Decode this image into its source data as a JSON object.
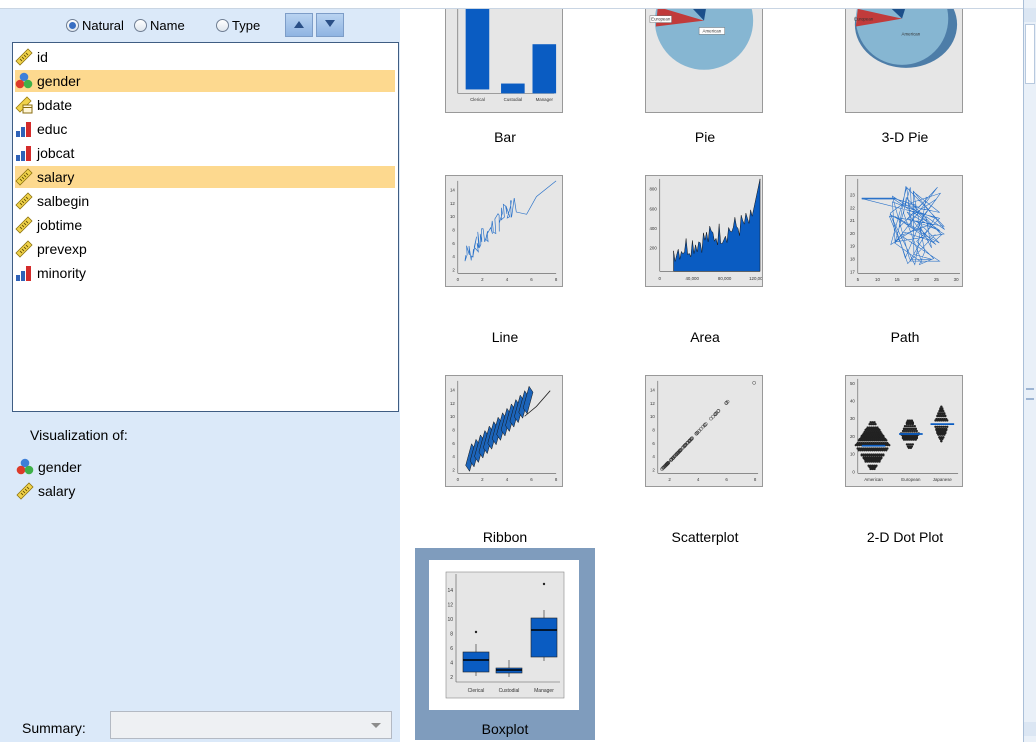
{
  "sort_options": [
    {
      "label": "Natural",
      "selected": true
    },
    {
      "label": "Name",
      "selected": false
    },
    {
      "label": "Type",
      "selected": false
    }
  ],
  "variables": [
    {
      "name": "id",
      "measure": "scale",
      "selected": false
    },
    {
      "name": "gender",
      "measure": "nominal",
      "selected": true
    },
    {
      "name": "bdate",
      "measure": "date",
      "selected": false
    },
    {
      "name": "educ",
      "measure": "ordinal",
      "selected": false
    },
    {
      "name": "jobcat",
      "measure": "ordinal",
      "selected": false
    },
    {
      "name": "salary",
      "measure": "scale",
      "selected": true
    },
    {
      "name": "salbegin",
      "measure": "scale",
      "selected": false
    },
    {
      "name": "jobtime",
      "measure": "scale",
      "selected": false
    },
    {
      "name": "prevexp",
      "measure": "scale",
      "selected": false
    },
    {
      "name": "minority",
      "measure": "ordinal",
      "selected": false
    }
  ],
  "visualization": {
    "label": "Visualization of:",
    "items": [
      {
        "name": "gender",
        "measure": "nominal"
      },
      {
        "name": "salary",
        "measure": "scale"
      }
    ]
  },
  "summary": {
    "label": "Summary:",
    "value": ""
  },
  "charts": [
    {
      "label": "Bar",
      "selected": false
    },
    {
      "label": "Pie",
      "selected": false
    },
    {
      "label": "3-D Pie",
      "selected": false
    },
    {
      "label": "Line",
      "selected": false
    },
    {
      "label": "Area",
      "selected": false
    },
    {
      "label": "Path",
      "selected": false
    },
    {
      "label": "Ribbon",
      "selected": false
    },
    {
      "label": "Scatterplot",
      "selected": false
    },
    {
      "label": "2-D Dot Plot",
      "selected": false
    },
    {
      "label": "Boxplot",
      "selected": true
    }
  ],
  "thumb_text": {
    "bar_cats": [
      "Clerical",
      "Custodial",
      "Manager"
    ],
    "pie_labels": [
      "European",
      "American",
      "Japanese"
    ],
    "line_x": [
      "0",
      "2",
      "4",
      "6",
      "8"
    ],
    "line_y": [
      "2",
      "4",
      "6",
      "8",
      "10",
      "12",
      "14"
    ],
    "area_x": [
      "0",
      "40,000",
      "80,000",
      "120,000"
    ],
    "area_y": [
      "200",
      "400",
      "600",
      "800"
    ],
    "path_x": [
      "5",
      "10",
      "15",
      "20",
      "25",
      "30"
    ],
    "path_y": [
      "17",
      "18",
      "19",
      "20",
      "21",
      "22",
      "23"
    ],
    "scatter_y": [
      "2",
      "4",
      "6",
      "8",
      "10",
      "12",
      "14"
    ],
    "scatter_x": [
      "2",
      "4",
      "6",
      "8"
    ],
    "dot_cats": [
      "American",
      "European",
      "Japanese"
    ],
    "dot_y": [
      "0",
      "10",
      "20",
      "30",
      "40",
      "50"
    ],
    "box_cats": [
      "Clerical",
      "Custodial",
      "Manager"
    ],
    "box_y": [
      "2",
      "4",
      "6",
      "8",
      "10",
      "12",
      "14"
    ]
  },
  "colors": {
    "accent": "#0a5cc2",
    "selection": "#fdd98f",
    "panel": "#dbe9f9",
    "selected_tile": "#7f9cbd"
  }
}
